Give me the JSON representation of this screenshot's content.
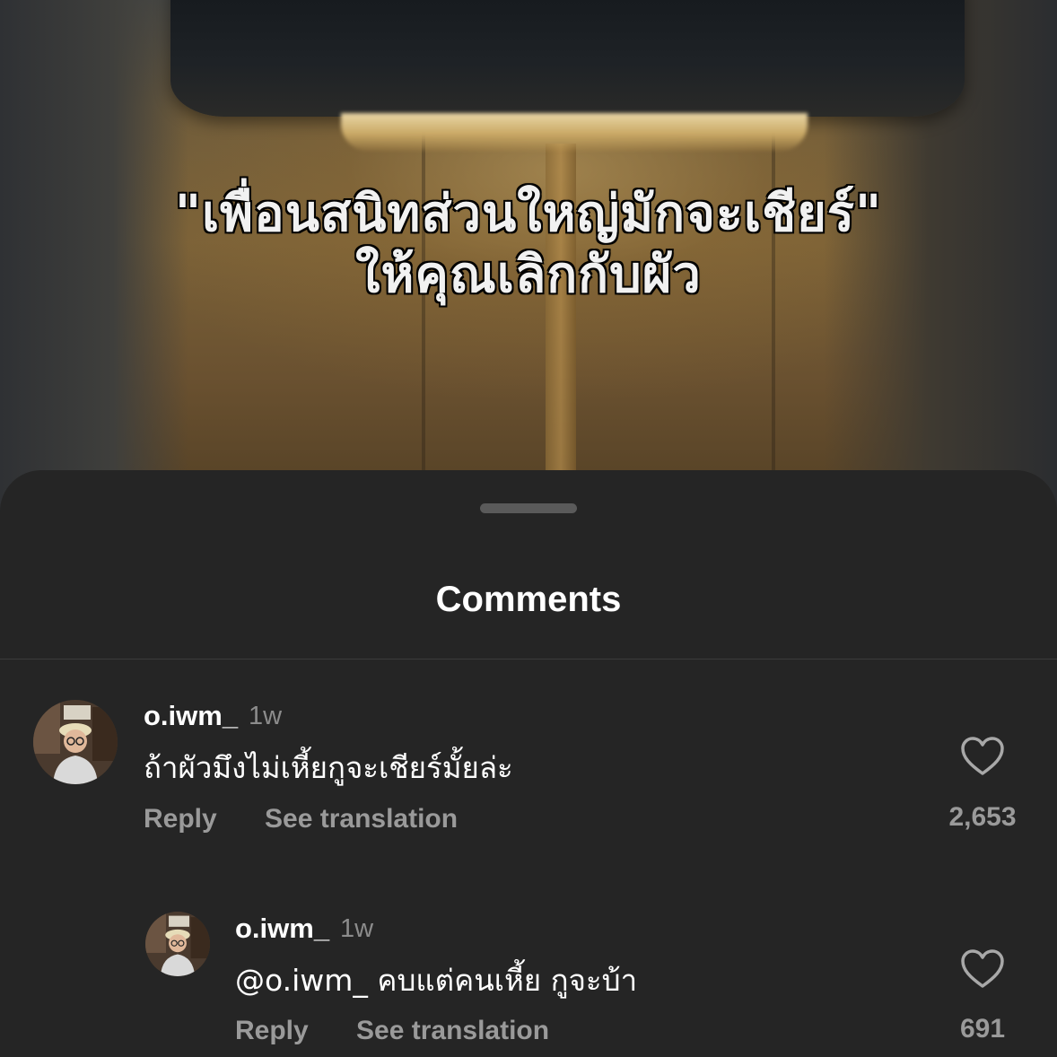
{
  "video": {
    "caption_line1": "\"เพื่อนสนิทส่วนใหญ่มักจะเชียร์\"",
    "caption_line2": "ให้คุณเลิกกับผัว"
  },
  "comments_sheet": {
    "title": "Comments",
    "comments": [
      {
        "username": "o.iwm_",
        "time": "1w",
        "text": "ถ้าผัวมึงไม่เหี้ยกูจะเชียร์มั้ยล่ะ",
        "reply_label": "Reply",
        "translate_label": "See translation",
        "likes": "2,653",
        "like_icon": "heart-outline-icon"
      },
      {
        "username": "o.iwm_",
        "time": "1w",
        "text": "@o.iwm_ คบแต่คนเหี้ย กูจะบ้า",
        "reply_label": "Reply",
        "translate_label": "See translation",
        "likes": "691",
        "like_icon": "heart-outline-icon",
        "is_reply": true
      }
    ]
  },
  "colors": {
    "sheet_background": "#252525",
    "primary_text": "#ffffff",
    "secondary_text": "#9a9a9a",
    "divider": "#3c3c3c"
  }
}
